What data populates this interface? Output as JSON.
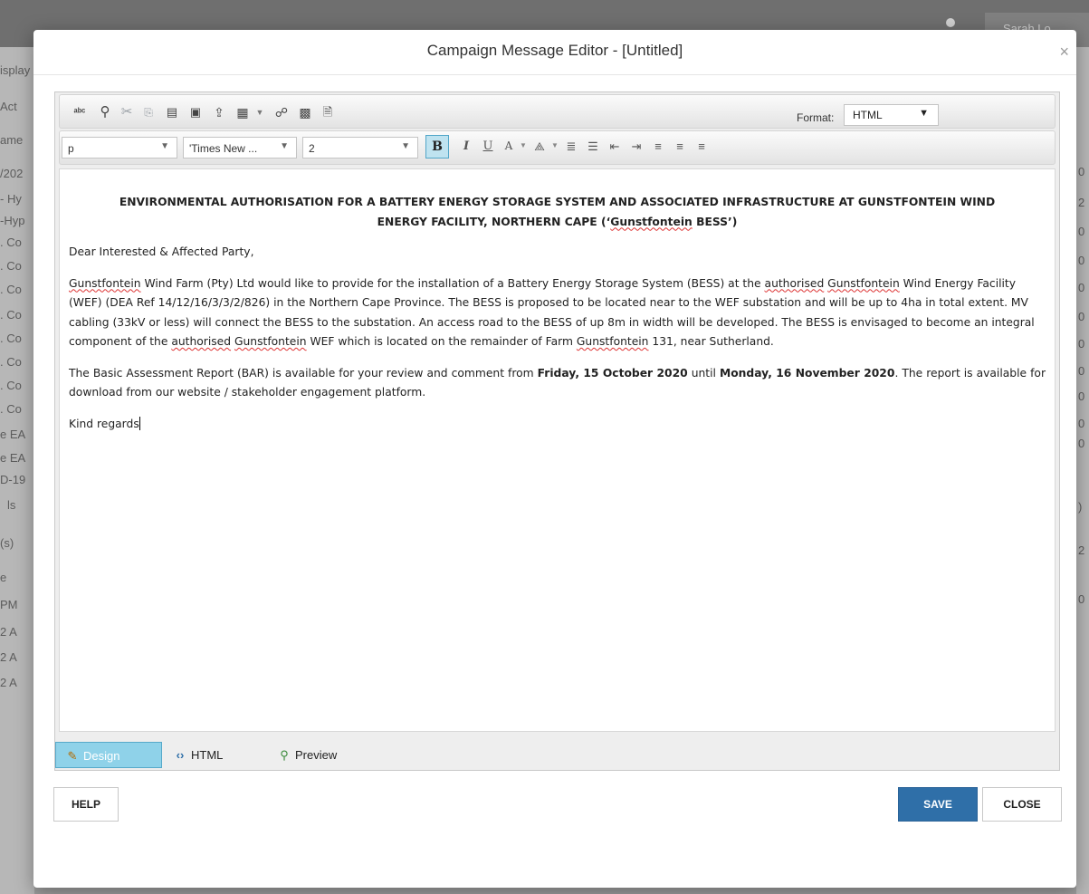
{
  "background": {
    "user_button": "Sarah Lo...",
    "left_fragments": [
      "isplay",
      "Act",
      "ame",
      "/202",
      "- Hy",
      "-Hyp",
      ". Co",
      ". Co",
      ". Co",
      ". Co",
      ". Co",
      ". Co",
      ". Co",
      ". Co",
      "e EA",
      "e EA",
      "D-19",
      "ls",
      "(s)",
      "e",
      "PM",
      "2 A",
      "2 A",
      "2 A"
    ],
    "right_fragments": [
      "0",
      "2",
      "0",
      "0",
      "0",
      "0",
      "0",
      "0",
      "0",
      "0",
      "0",
      ")",
      "2",
      "0"
    ]
  },
  "modal": {
    "title": "Campaign Message Editor - [Untitled]",
    "close_glyph": "×"
  },
  "toolbar": {
    "icons_row1": [
      "spellcheck-icon",
      "find-icon",
      "cut-icon",
      "copy-icon",
      "paste-icon",
      "paste-text-icon",
      "paste-html-icon",
      "table-icon",
      "link-icon",
      "image-icon",
      "file-icon"
    ],
    "format_label": "Format:",
    "format_value": "HTML",
    "paragraph_value": "p",
    "font_value": "'Times New ...",
    "size_value": "2",
    "bold": "B",
    "italic": "I",
    "underline": "U",
    "font_color": "A",
    "highlight": "⟁"
  },
  "document": {
    "heading_line1": "ENVIRONMENTAL AUTHORISATION FOR A BATTERY ENERGY STORAGE SYSTEM AND ASSOCIATED INFRASTRUCTURE AT GUNSTFONTEIN WIND",
    "heading_line2_a": "ENERGY FACILITY, NORTHERN CAPE (‘",
    "heading_line2_b": "Gunstfontein",
    "heading_line2_c": " BESS’)",
    "greeting": "Dear Interested & Affected Party,",
    "p1": {
      "s1": "Gunstfontein",
      "s2": " Wind Farm (Pty) Ltd would like to provide for the installation of a Battery Energy Storage System (BESS) at the ",
      "s3": "authorised",
      "s4": "Gunstfontein",
      "s5": " Wind Energy Facility (WEF) (DEA Ref 14/12/16/3/3/2/826) in the Northern Cape Province.  The BESS is proposed to be located near to the WEF substation and will be up to 4ha in total extent. MV cabling (33kV or less) will connect the BESS to the substation. An access road to the BESS of up 8m in width will be developed. The BESS is envisaged to become an integral component of the ",
      "s6": "authorised",
      "s7": " ",
      "s8": "Gunstfontein",
      "s9": " WEF which is located on the remainder of Farm ",
      "s10": "Gunstfontein",
      "s11": " 131, near Sutherland."
    },
    "p2": {
      "a": "The Basic Assessment Report (BAR) is available for your review and comment from ",
      "b": "Friday, 15 October 2020",
      "c": " until ",
      "d": "Monday, 16 November 2020",
      "e": ".  The report is available for download from our website / stakeholder engagement platform."
    },
    "closing": "Kind regards"
  },
  "modes": {
    "design": "Design",
    "html": "HTML",
    "preview": "Preview"
  },
  "buttons": {
    "help": "HELP",
    "save": "SAVE",
    "close": "CLOSE"
  },
  "colors": {
    "save": "#2f6fa8",
    "active_tab": "#8fd2e9"
  }
}
